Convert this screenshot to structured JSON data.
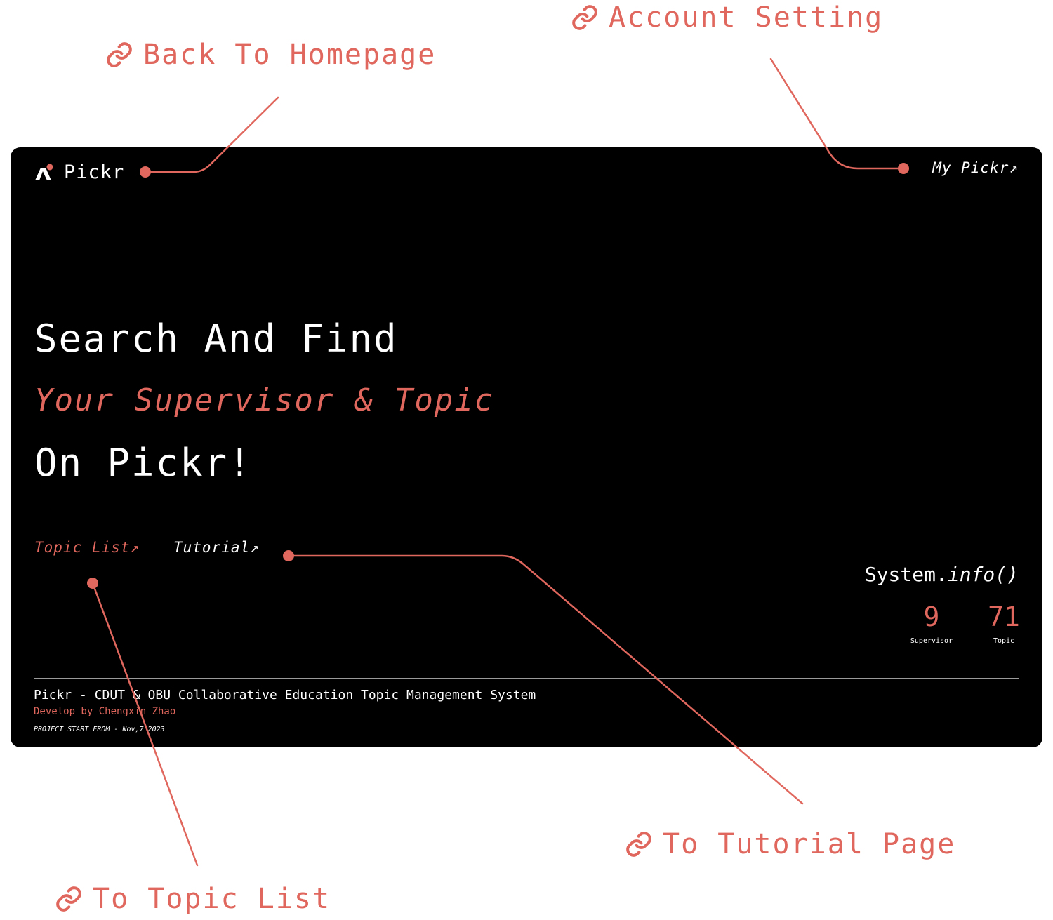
{
  "annotations": {
    "back_homepage": "Back To Homepage",
    "account_setting": "Account Setting",
    "to_tutorial": "To Tutorial Page",
    "to_topic_list": "To Topic List"
  },
  "header": {
    "brand": "Pickr",
    "my_link": "My Pickr↗"
  },
  "hero": {
    "line1": "Search And Find",
    "line2": "Your Supervisor & Topic",
    "line3": "On Pickr!"
  },
  "nav": {
    "topic_list": "Topic List↗",
    "tutorial": "Tutorial↗"
  },
  "system": {
    "title_plain": "System.",
    "title_fn": "info()",
    "stats": [
      {
        "value": "9",
        "label": "Supervisor"
      },
      {
        "value": "71",
        "label": "Topic"
      }
    ]
  },
  "footer": {
    "title": "Pickr - CDUT & OBU Collaborative Education Topic Management System",
    "developer": "Develop by Chengxin Zhao",
    "start": "PROJECT START FROM - Nov,7 2023"
  },
  "colors": {
    "accent": "#e0675d",
    "background": "#000000",
    "text": "#ffffff"
  },
  "icons": [
    "link-icon",
    "logo-icon"
  ]
}
